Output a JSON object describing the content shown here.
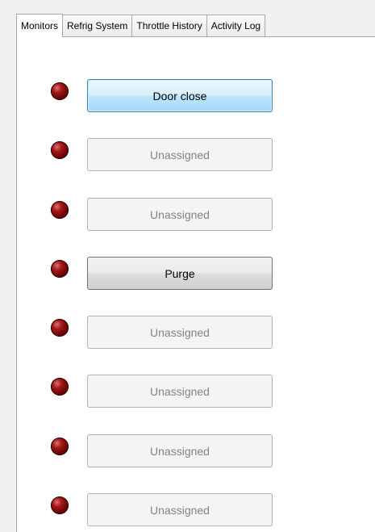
{
  "tabs": [
    {
      "label": "Monitors",
      "selected": true
    },
    {
      "label": "Refrig System",
      "selected": false
    },
    {
      "label": "Throttle History",
      "selected": false
    },
    {
      "label": "Activity Log",
      "selected": false
    }
  ],
  "indicator_color": "#8b0a0a",
  "monitors": [
    {
      "label": "Door close",
      "state": "focused"
    },
    {
      "label": "Unassigned",
      "state": "disabled"
    },
    {
      "label": "Unassigned",
      "state": "disabled"
    },
    {
      "label": "Purge",
      "state": "active"
    },
    {
      "label": "Unassigned",
      "state": "disabled"
    },
    {
      "label": "Unassigned",
      "state": "disabled"
    },
    {
      "label": "Unassigned",
      "state": "disabled"
    },
    {
      "label": "Unassigned",
      "state": "disabled"
    }
  ]
}
